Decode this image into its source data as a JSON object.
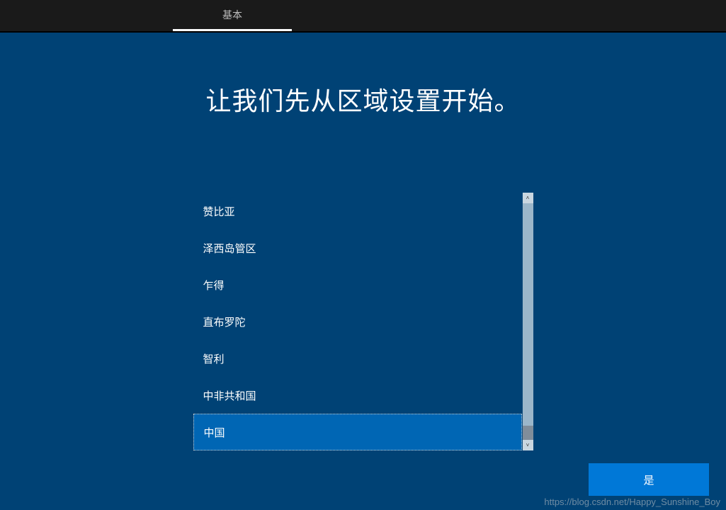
{
  "topbar": {
    "tab_label": "基本"
  },
  "main": {
    "title": "让我们先从区域设置开始。"
  },
  "region_list": {
    "items": [
      {
        "label": "赞比亚",
        "selected": false
      },
      {
        "label": "泽西岛管区",
        "selected": false
      },
      {
        "label": "乍得",
        "selected": false
      },
      {
        "label": "直布罗陀",
        "selected": false
      },
      {
        "label": "智利",
        "selected": false
      },
      {
        "label": "中非共和国",
        "selected": false
      },
      {
        "label": "中国",
        "selected": true
      }
    ]
  },
  "confirm": {
    "label": "是"
  },
  "watermark": {
    "text": "https://blog.csdn.net/Happy_Sunshine_Boy"
  }
}
